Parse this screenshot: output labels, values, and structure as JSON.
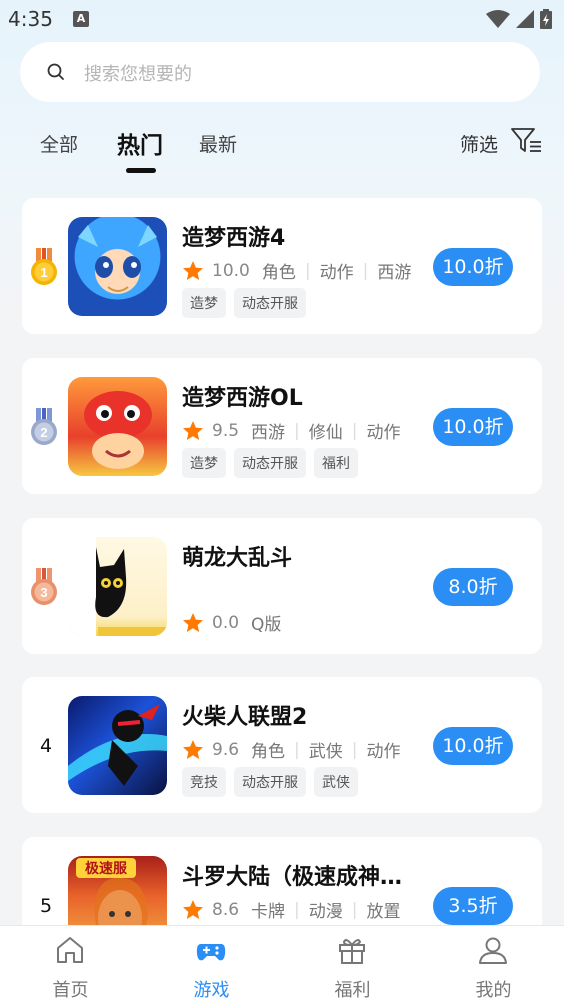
{
  "status_bar": {
    "time": "4:35",
    "notification_icon": "text-a-icon"
  },
  "search": {
    "placeholder": "搜索您想要的"
  },
  "tabs": [
    {
      "label": "全部",
      "active": false
    },
    {
      "label": "热门",
      "active": true
    },
    {
      "label": "最新",
      "active": false
    }
  ],
  "filter": {
    "label": "筛选"
  },
  "games": [
    {
      "rank": "1",
      "name": "造梦西游4",
      "score": "10.0",
      "categories": [
        "角色",
        "动作",
        "西游"
      ],
      "tags": [
        "造梦",
        "动态开服"
      ],
      "discount": "10.0折"
    },
    {
      "rank": "2",
      "name": "造梦西游OL",
      "score": "9.5",
      "categories": [
        "西游",
        "修仙",
        "动作"
      ],
      "tags": [
        "造梦",
        "动态开服",
        "福利"
      ],
      "discount": "10.0折"
    },
    {
      "rank": "3",
      "name": "萌龙大乱斗",
      "score": "0.0",
      "categories": [
        "Q版"
      ],
      "tags": [],
      "discount": "8.0折"
    },
    {
      "rank": "4",
      "name": "火柴人联盟2",
      "score": "9.6",
      "categories": [
        "角色",
        "武侠",
        "动作"
      ],
      "tags": [
        "竞技",
        "动态开服",
        "武侠"
      ],
      "discount": "10.0折"
    },
    {
      "rank": "5",
      "name": "斗罗大陆（极速成神…",
      "score": "8.6",
      "categories": [
        "卡牌",
        "动漫",
        "放置"
      ],
      "tags": [],
      "discount": "3.5折",
      "thumb_badge": "极速服"
    }
  ],
  "bottom_nav": [
    {
      "label": "首页",
      "icon": "home-icon",
      "active": false
    },
    {
      "label": "游戏",
      "icon": "gamepad-icon",
      "active": true
    },
    {
      "label": "福利",
      "icon": "gift-icon",
      "active": false
    },
    {
      "label": "我的",
      "icon": "user-icon",
      "active": false
    }
  ],
  "colors": {
    "accent": "#2b8ef5",
    "star": "#ff7a00",
    "gold_medal": "#f5b400",
    "silver_medal": "#9aa8c9",
    "bronze_medal": "#e7906a"
  }
}
